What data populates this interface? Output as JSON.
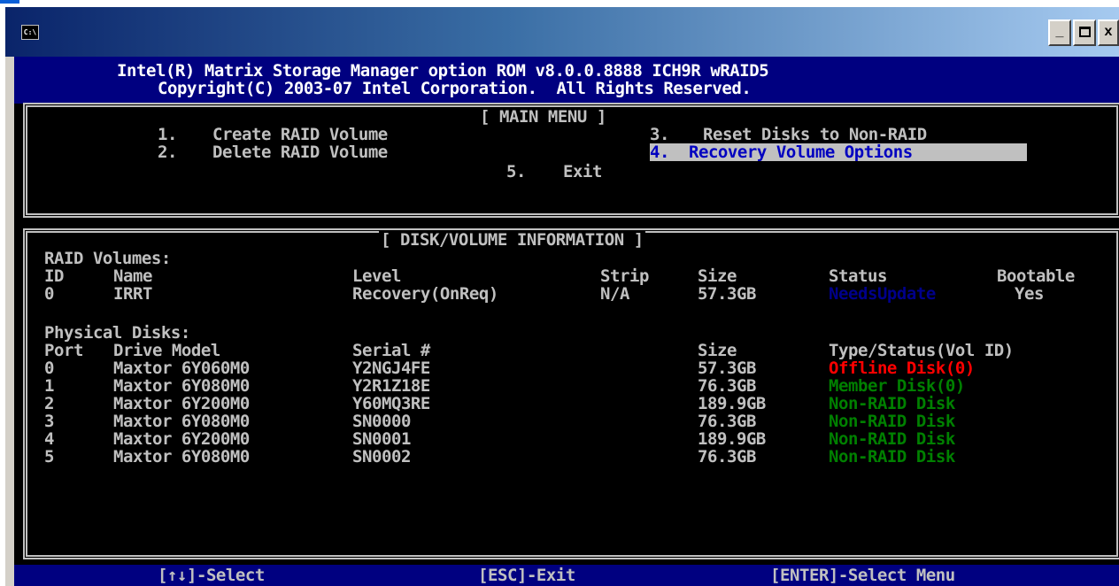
{
  "window": {
    "icon_label": "C:\\",
    "minimize_glyph": "_",
    "close_glyph": "x"
  },
  "header": {
    "line1": "Intel(R) Matrix Storage Manager option ROM v8.0.0.8888 ICH9R wRAID5",
    "line2": "Copyright(C) 2003-07 Intel Corporation.  All Rights Reserved."
  },
  "main_menu": {
    "title": "MAIN MENU",
    "items": [
      {
        "num": "1.",
        "label": "Create RAID Volume"
      },
      {
        "num": "2.",
        "label": "Delete RAID Volume"
      },
      {
        "num": "3.",
        "label": "Reset Disks to Non-RAID"
      },
      {
        "num": "4.",
        "label": "Recovery Volume Options"
      },
      {
        "num": "5.",
        "label": "Exit"
      }
    ],
    "selected_index": 3
  },
  "info": {
    "title": "DISK/VOLUME INFORMATION",
    "raid_section": "RAID Volumes:",
    "raid_headers": {
      "id": "ID",
      "name": "Name",
      "level": "Level",
      "strip": "Strip",
      "size": "Size",
      "status": "Status",
      "bootable": "Bootable"
    },
    "raid_rows": [
      {
        "id": "0",
        "name": "IRRT",
        "level": "Recovery(OnReq)",
        "strip": "N/A",
        "size": "57.3GB",
        "status": "NeedsUpdate",
        "bootable": "Yes"
      }
    ],
    "disk_section": "Physical Disks:",
    "disk_headers": {
      "port": "Port",
      "model": "Drive Model",
      "serial": "Serial #",
      "size": "Size",
      "type": "Type/Status(Vol ID)"
    },
    "disks": [
      {
        "port": "0",
        "model": "Maxtor 6Y060M0",
        "serial": "Y2NGJ4FE",
        "size": "57.3GB",
        "type": "Offline Disk(0)",
        "status_color": "#ff0000"
      },
      {
        "port": "1",
        "model": "Maxtor 6Y080M0",
        "serial": "Y2R1Z18E",
        "size": "76.3GB",
        "type": "Member Disk(0)",
        "status_color": "#008000"
      },
      {
        "port": "2",
        "model": "Maxtor 6Y200M0",
        "serial": "Y60MQ3RE",
        "size": "189.9GB",
        "type": "Non-RAID Disk",
        "status_color": "#008000"
      },
      {
        "port": "3",
        "model": "Maxtor 6Y080M0",
        "serial": "SN0000",
        "size": "76.3GB",
        "type": "Non-RAID Disk",
        "status_color": "#008000"
      },
      {
        "port": "4",
        "model": "Maxtor 6Y200M0",
        "serial": "SN0001",
        "size": "189.9GB",
        "type": "Non-RAID Disk",
        "status_color": "#008000"
      },
      {
        "port": "5",
        "model": "Maxtor 6Y080M0",
        "serial": "SN0002",
        "size": "76.3GB",
        "type": "Non-RAID Disk",
        "status_color": "#008000"
      }
    ]
  },
  "footer": {
    "select": "[↑↓]-Select",
    "exit": "[ESC]-Exit",
    "enter": "[ENTER]-Select Menu"
  },
  "colors": {
    "console_bg": "#000000",
    "header_bg": "#000080",
    "text": "#c0c0c0",
    "selected_bg": "#c0c0c0",
    "selected_fg": "#0000c0",
    "title_blue": "#0000e0"
  }
}
